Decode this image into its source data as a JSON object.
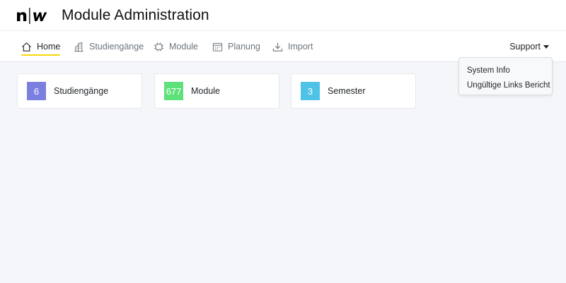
{
  "header": {
    "title": "Module Administration"
  },
  "nav": {
    "home": "Home",
    "studiengaenge": "Studiengänge",
    "module": "Module",
    "planung": "Planung",
    "import": "Import"
  },
  "support": {
    "label": "Support",
    "menu": [
      "System Info",
      "Ungültige Links Bericht"
    ]
  },
  "cards": [
    {
      "count": "6",
      "label": "Studiengänge",
      "color": "#7b7fe0"
    },
    {
      "count": "677",
      "label": "Module",
      "color": "#5ee07a"
    },
    {
      "count": "3",
      "label": "Semester",
      "color": "#4fc3e6"
    }
  ]
}
